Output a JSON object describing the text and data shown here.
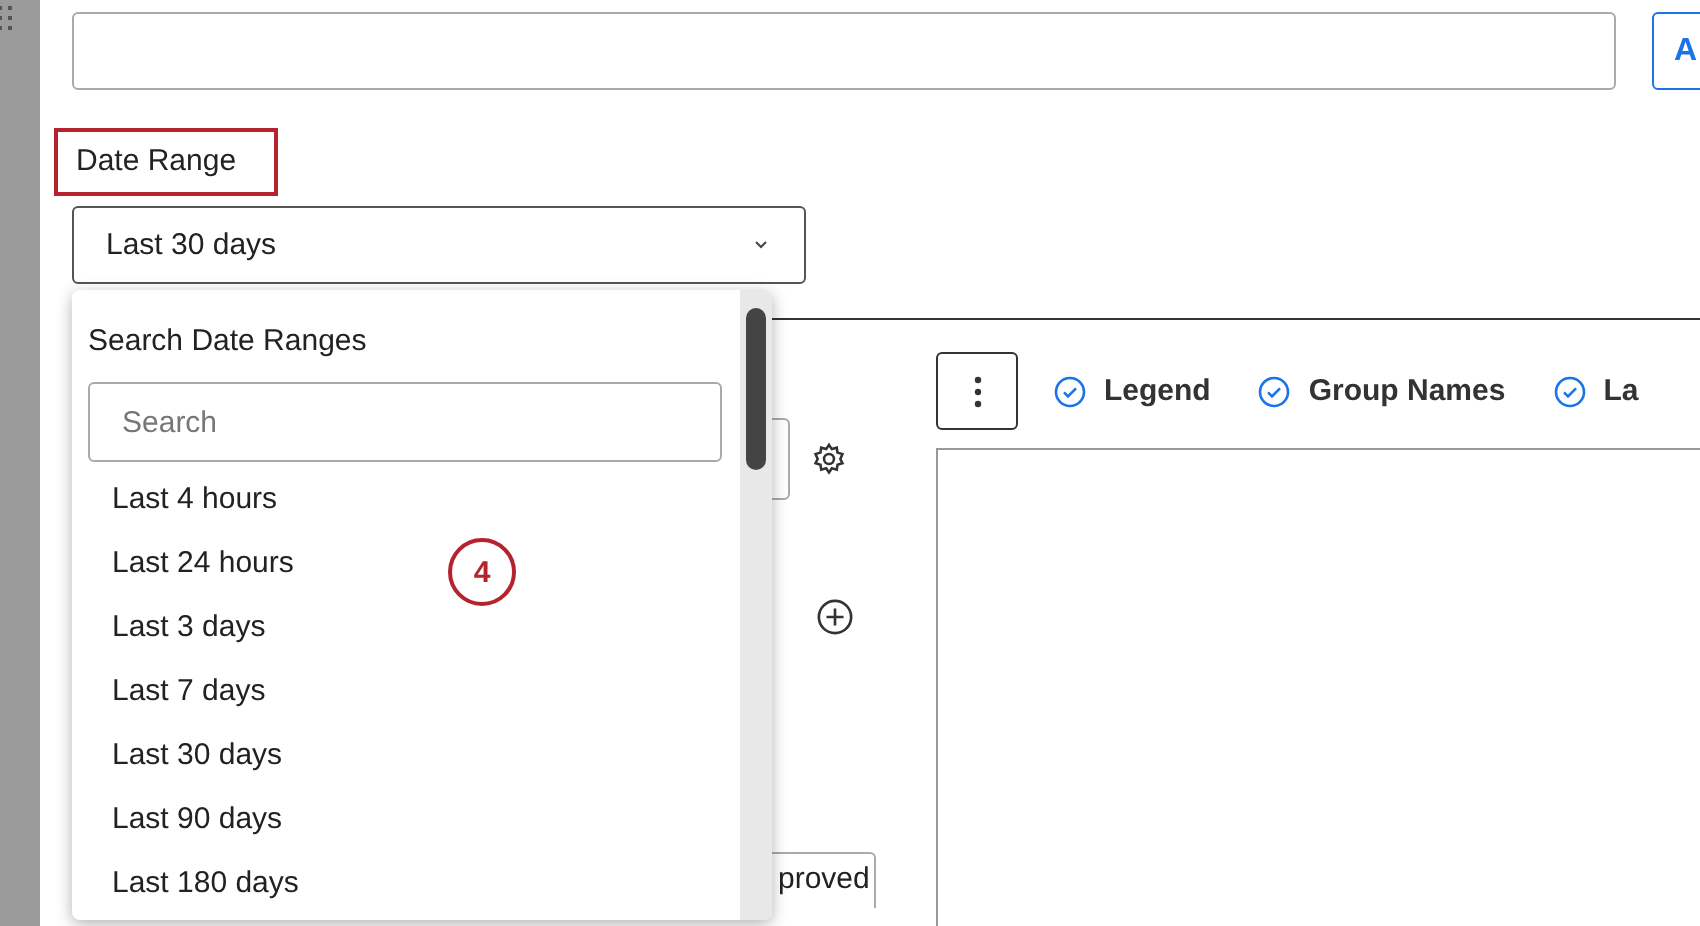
{
  "top_button": {
    "label": "A"
  },
  "date_range": {
    "label": "Date Range",
    "highlighted": true,
    "value": "Last 30 days",
    "expanded": true
  },
  "dropdown": {
    "title": "Search Date Ranges",
    "search": {
      "placeholder": "Search"
    },
    "options": [
      {
        "label": "Last 4 hours"
      },
      {
        "label": "Last 24 hours"
      },
      {
        "label": "Last 3 days"
      },
      {
        "label": "Last 7 days"
      },
      {
        "label": "Last 30 days"
      },
      {
        "label": "Last 90 days"
      },
      {
        "label": "Last 180 days"
      }
    ]
  },
  "callout": {
    "label": "4"
  },
  "toolbar": {
    "toggles": [
      {
        "label": "Legend",
        "checked": true
      },
      {
        "label": "Group Names",
        "checked": true
      },
      {
        "label": "La",
        "checked": true
      }
    ]
  },
  "status_field": {
    "value": "proved"
  }
}
